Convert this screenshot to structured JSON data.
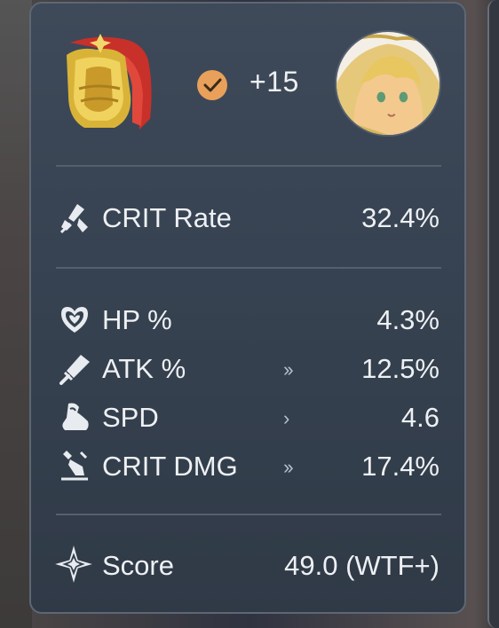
{
  "header": {
    "level": "+15",
    "relic_icon": "golden-chestplate-red-cape",
    "check_icon": "check-circle-icon",
    "avatar_icon": "character-portrait-blonde",
    "check_color": "#e8a05a"
  },
  "main_stat": {
    "name": "CRIT Rate",
    "value": "32.4%",
    "icon": "crit-rate-icon"
  },
  "sub_stats": [
    {
      "name": "HP %",
      "value": "4.3%",
      "rolls": "",
      "icon": "heart-icon"
    },
    {
      "name": "ATK %",
      "value": "12.5%",
      "rolls": "››",
      "icon": "sword-icon"
    },
    {
      "name": "SPD",
      "value": "4.6",
      "rolls": "›",
      "icon": "boot-icon"
    },
    {
      "name": "CRIT DMG",
      "value": "17.4%",
      "rolls": "››",
      "icon": "crit-dmg-icon"
    }
  ],
  "score": {
    "label": "Score",
    "value": "49.0 (WTF+)",
    "icon": "score-star-icon"
  }
}
